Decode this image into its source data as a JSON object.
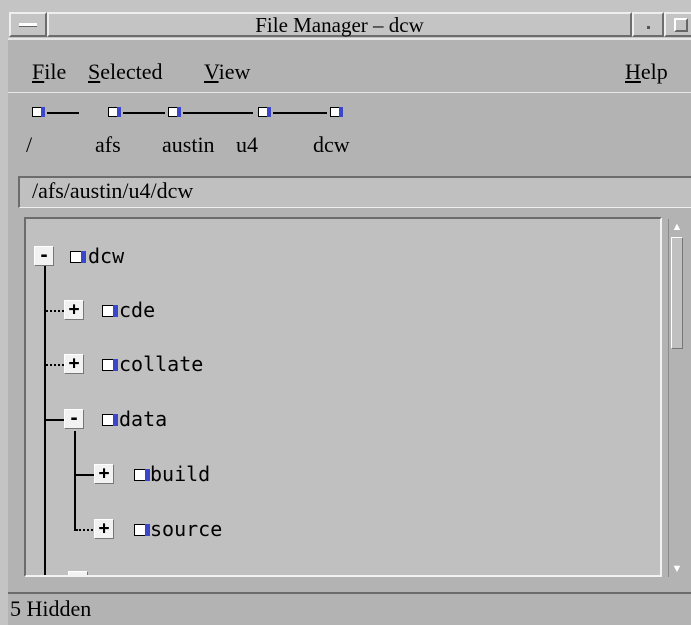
{
  "window": {
    "title": "File Manager – dcw"
  },
  "menubar": {
    "items": [
      {
        "label": "File",
        "mnemonic": "F",
        "rest": "ile"
      },
      {
        "label": "Selected",
        "mnemonic": "S",
        "rest": "elected"
      },
      {
        "label": "View",
        "mnemonic": "V",
        "rest": "iew"
      },
      {
        "label": "Help",
        "mnemonic": "H",
        "rest": "elp"
      }
    ]
  },
  "breadcrumb": {
    "segments": [
      "/",
      "afs",
      "austin",
      "u4",
      "dcw"
    ]
  },
  "path_field": {
    "value": "/afs/austin/u4/dcw"
  },
  "tree": {
    "nodes": [
      {
        "label": "dcw",
        "toggle": "-"
      },
      {
        "label": "cde",
        "toggle": "+"
      },
      {
        "label": "collate",
        "toggle": "+"
      },
      {
        "label": "data",
        "toggle": "-"
      },
      {
        "label": "build",
        "toggle": "+"
      },
      {
        "label": "source",
        "toggle": "+"
      }
    ]
  },
  "status": {
    "text": "5 Hidden"
  },
  "colors": {
    "background": "#b3b3b3",
    "field": "#c0c0c0",
    "folder_accent": "#3c46c8"
  },
  "icons": [
    "window-menu-icon",
    "minimize-icon",
    "maximize-icon",
    "folder-icon",
    "scroll-up-arrow-icon",
    "scroll-down-arrow-icon"
  ]
}
